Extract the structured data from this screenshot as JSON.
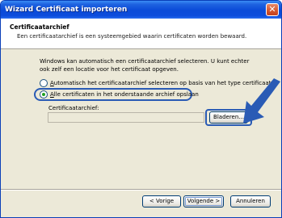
{
  "window": {
    "title": "Wizard Certificaat importeren",
    "close_icon": "close-icon"
  },
  "header": {
    "title": "Certificaatarchief",
    "subtitle": "Een certificaatarchief is een systeemgebied waarin certificaten worden bewaard."
  },
  "body": {
    "description": "Windows kan automatisch een certificaatarchief selecteren. U kunt echter ook zelf een locatie voor het certificaat opgeven.",
    "option_auto": {
      "accel": "A",
      "rest": "utomatisch het certificaatarchief selecteren op basis van het type certificaat",
      "selected": false
    },
    "option_manual": {
      "accel": "A",
      "rest": "lle certificaten in het onderstaande archief opslaan",
      "selected": true
    },
    "store_label": "Certificaatarchief:",
    "store_value": "",
    "browse_label": "Bladeren..."
  },
  "footer": {
    "back_label": "< Vorige",
    "next_label": "Volgende >",
    "cancel_label": "Annuleren"
  },
  "colors": {
    "highlight": "#2a5bb5",
    "arrow": "#2a5bb5",
    "titlebar": "#0a4ad8"
  }
}
